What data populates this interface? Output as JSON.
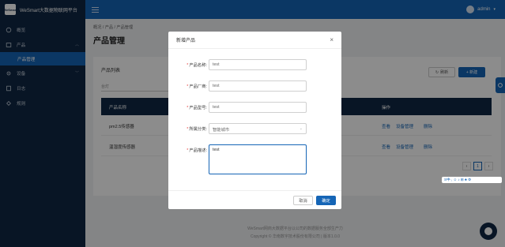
{
  "app": {
    "title": "WeSmart大数据物联网平台",
    "logo_text": "WeSmart"
  },
  "header": {
    "user": "admin"
  },
  "sidebar": {
    "items": [
      {
        "label": "概览",
        "icon": "home-icon"
      },
      {
        "label": "产品",
        "icon": "product-icon",
        "expanded": true
      },
      {
        "label": "设备",
        "icon": "device-icon"
      },
      {
        "label": "日志",
        "icon": "log-icon"
      },
      {
        "label": "规则",
        "icon": "rule-icon"
      }
    ],
    "sub_item": "产品管理"
  },
  "breadcrumb": "概况 / 产品 / 产品管理",
  "page_title": "产品管理",
  "card": {
    "title": "产品列表",
    "filter_placeholder": "台灯",
    "refresh_label": "刷新",
    "add_label": "+ 新建",
    "columns": [
      "产品名称",
      "操作"
    ],
    "rows": [
      {
        "name": "pm2.5传感器",
        "ops": [
          "查看",
          "设备管理",
          "删除"
        ]
      },
      {
        "name": "温湿度传感器",
        "ops": [
          "查看",
          "设备管理",
          "删除"
        ]
      }
    ],
    "page": "1"
  },
  "footer": {
    "line1": "WeSmart网商大数据平台以公司的数据服务全部生产力",
    "line2": "Copyright © 华南数字技术股份有限公司 | 版本1.0.0"
  },
  "modal": {
    "title": "新增产品",
    "fields": [
      {
        "label": "产品名称:",
        "value": "test"
      },
      {
        "label": "产品厂商:",
        "value": "test"
      },
      {
        "label": "产品型号:",
        "value": "test"
      },
      {
        "label": "所属分类:",
        "value": "智能城市"
      },
      {
        "label": "产品描述:",
        "value": "test"
      }
    ],
    "cancel_label": "取消",
    "ok_label": "确定"
  },
  "ime": {
    "label": "S中·, ☺ ♪ ⊞ ♣ ⚙"
  },
  "colors": {
    "primary": "#1565b6",
    "sidebar": "#0f2744",
    "required": "#e53935"
  }
}
